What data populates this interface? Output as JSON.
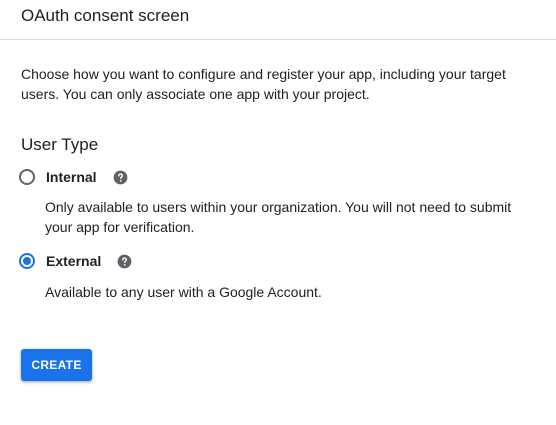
{
  "header": {
    "title": "OAuth consent screen"
  },
  "intro": {
    "text": "Choose how you want to configure and register your app, including your target users. You can only associate one app with your project."
  },
  "user_type": {
    "title": "User Type",
    "selected": "external",
    "options": [
      {
        "id": "internal",
        "label": "Internal",
        "description": "Only available to users within your organization. You will not need to submit your app for verification.",
        "checked": false,
        "help_icon": "help-circle-icon"
      },
      {
        "id": "external",
        "label": "External",
        "description": "Available to any user with a Google Account.",
        "checked": true,
        "help_icon": "help-circle-icon"
      }
    ]
  },
  "actions": {
    "create_label": "CREATE"
  },
  "colors": {
    "accent": "#1a73e8",
    "text": "#202124",
    "radio_unchecked": "#5f6368",
    "divider": "#dadce0",
    "help_icon": "#5f6368"
  }
}
